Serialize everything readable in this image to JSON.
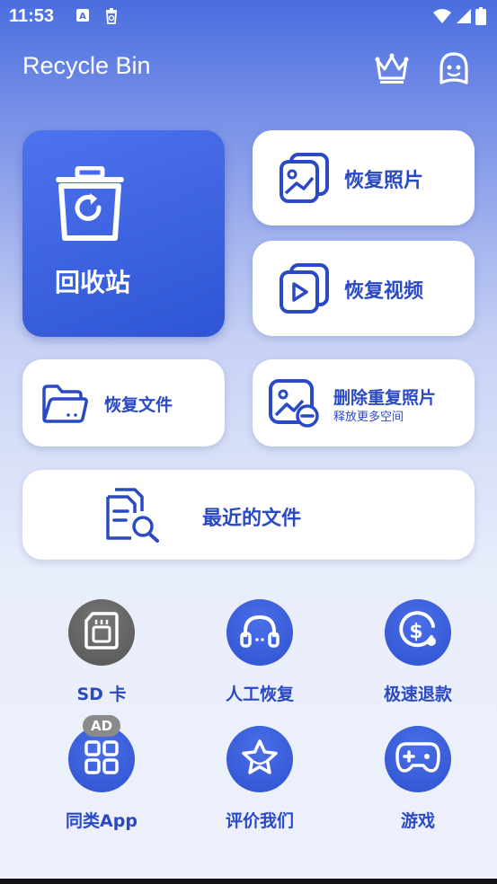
{
  "status_bar": {
    "time": "11:53"
  },
  "header": {
    "title": "Recycle Bin",
    "crown_icon": "crown-icon",
    "profile_icon": "robot-face-icon"
  },
  "main": {
    "recycle_bin_label": "回收站",
    "recover_photos_label": "恢复照片",
    "recover_videos_label": "恢复视频",
    "recover_files_label": "恢复文件",
    "delete_duplicates_label": "删除重复照片",
    "delete_duplicates_sub": "释放更多空间",
    "recent_files_label": "最近的文件"
  },
  "grid": {
    "sd_card": "SD 卡",
    "manual_recovery": "人工恢复",
    "fast_refund": "极速退款",
    "similar_apps": "同类App",
    "ad_badge": "AD",
    "rate_us": "评价我们",
    "games": "游戏"
  },
  "colors": {
    "accent": "#2f52cf",
    "card": "#ffffff",
    "text_blue": "#2a49c4"
  }
}
